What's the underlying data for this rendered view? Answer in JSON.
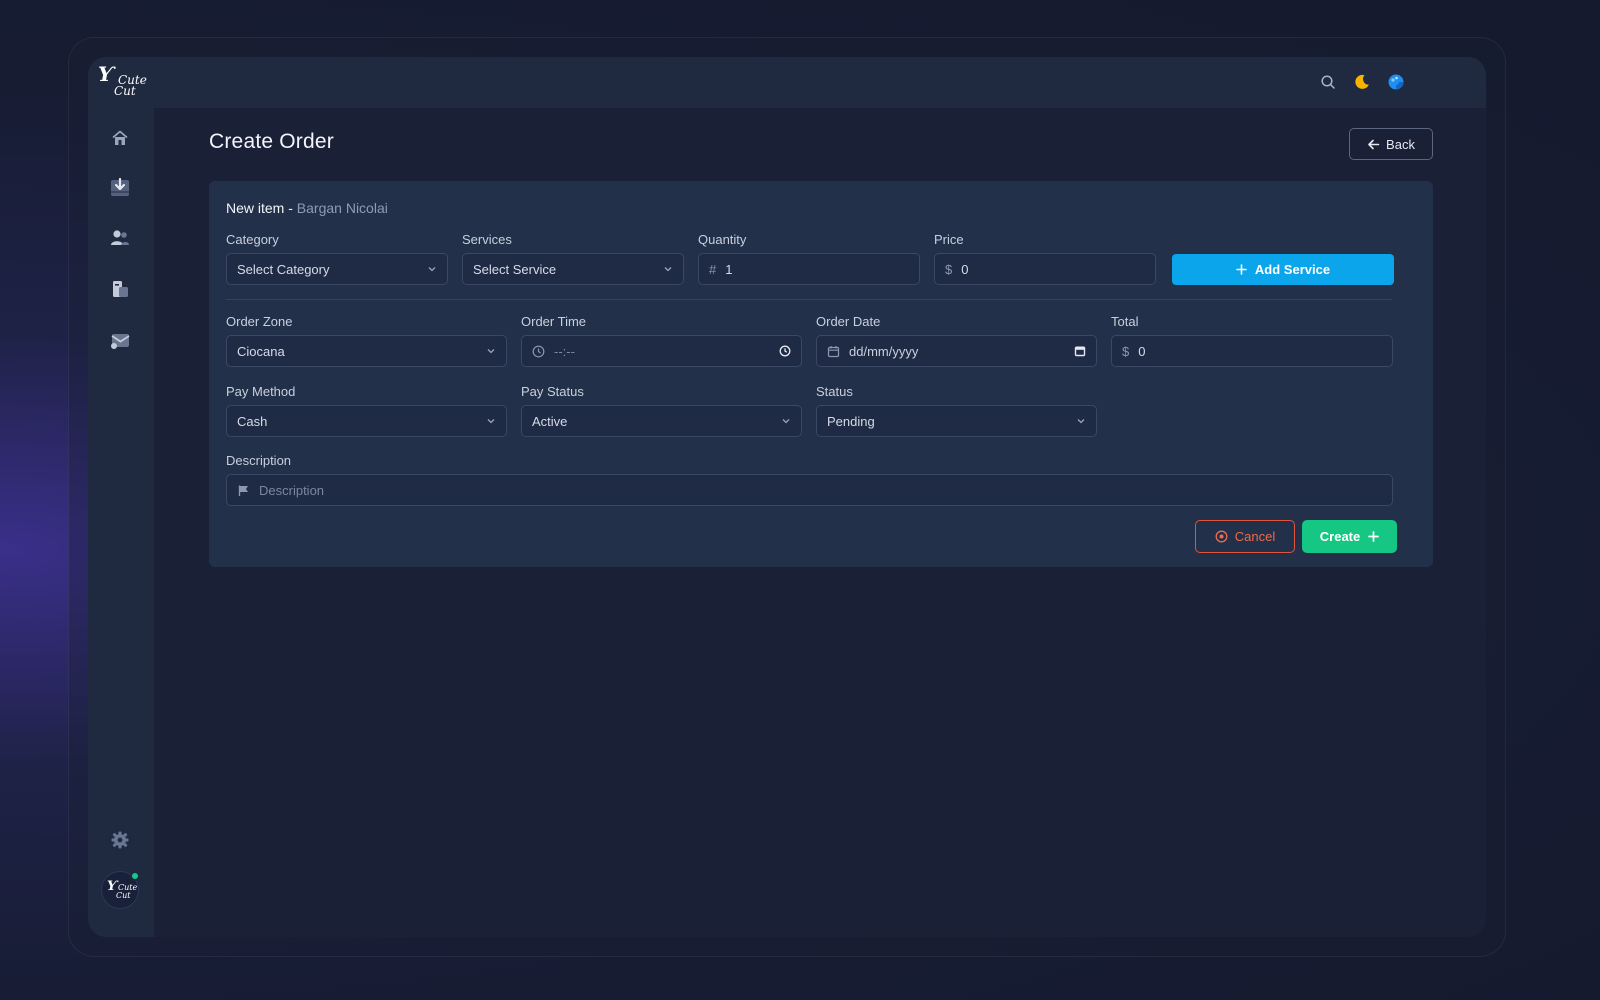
{
  "brand": {
    "logo_line1": "Cute",
    "logo_line2": "Cut"
  },
  "sidebar": {
    "items": [
      {
        "icon": "home-icon"
      },
      {
        "icon": "download-tray-icon"
      },
      {
        "icon": "users-icon"
      },
      {
        "icon": "reports-icon"
      },
      {
        "icon": "mail-icon"
      }
    ],
    "settings_icon": "gear-icon"
  },
  "topbar": {
    "icons": [
      "search-icon",
      "moon-icon",
      "palette-icon"
    ]
  },
  "page": {
    "title": "Create Order",
    "back_label": "Back"
  },
  "card": {
    "heading": "New item - ",
    "heading_name": "Bargan Nicolai",
    "category": {
      "label": "Category",
      "value": "Select Category"
    },
    "services": {
      "label": "Services",
      "value": "Select Service"
    },
    "quantity": {
      "label": "Quantity",
      "prefix": "#",
      "value": "1"
    },
    "price": {
      "label": "Price",
      "prefix": "$",
      "value": "0"
    },
    "add_service_label": "Add Service",
    "order_zone": {
      "label": "Order Zone",
      "value": "Ciocana"
    },
    "order_time": {
      "label": "Order Time",
      "placeholder": "--:--"
    },
    "order_date": {
      "label": "Order Date",
      "placeholder": "dd/mm/yyyy"
    },
    "total": {
      "label": "Total",
      "prefix": "$",
      "value": "0"
    },
    "pay_method": {
      "label": "Pay Method",
      "value": "Cash"
    },
    "pay_status": {
      "label": "Pay Status",
      "value": "Active"
    },
    "status": {
      "label": "Status",
      "value": "Pending"
    },
    "description": {
      "label": "Description",
      "placeholder": "Description"
    },
    "cancel_label": "Cancel",
    "create_label": "Create"
  },
  "colors": {
    "accent_blue": "#0aa5ea",
    "success_green": "#16c784",
    "danger_orange": "#e0553c",
    "moon_yellow": "#f5b400"
  }
}
